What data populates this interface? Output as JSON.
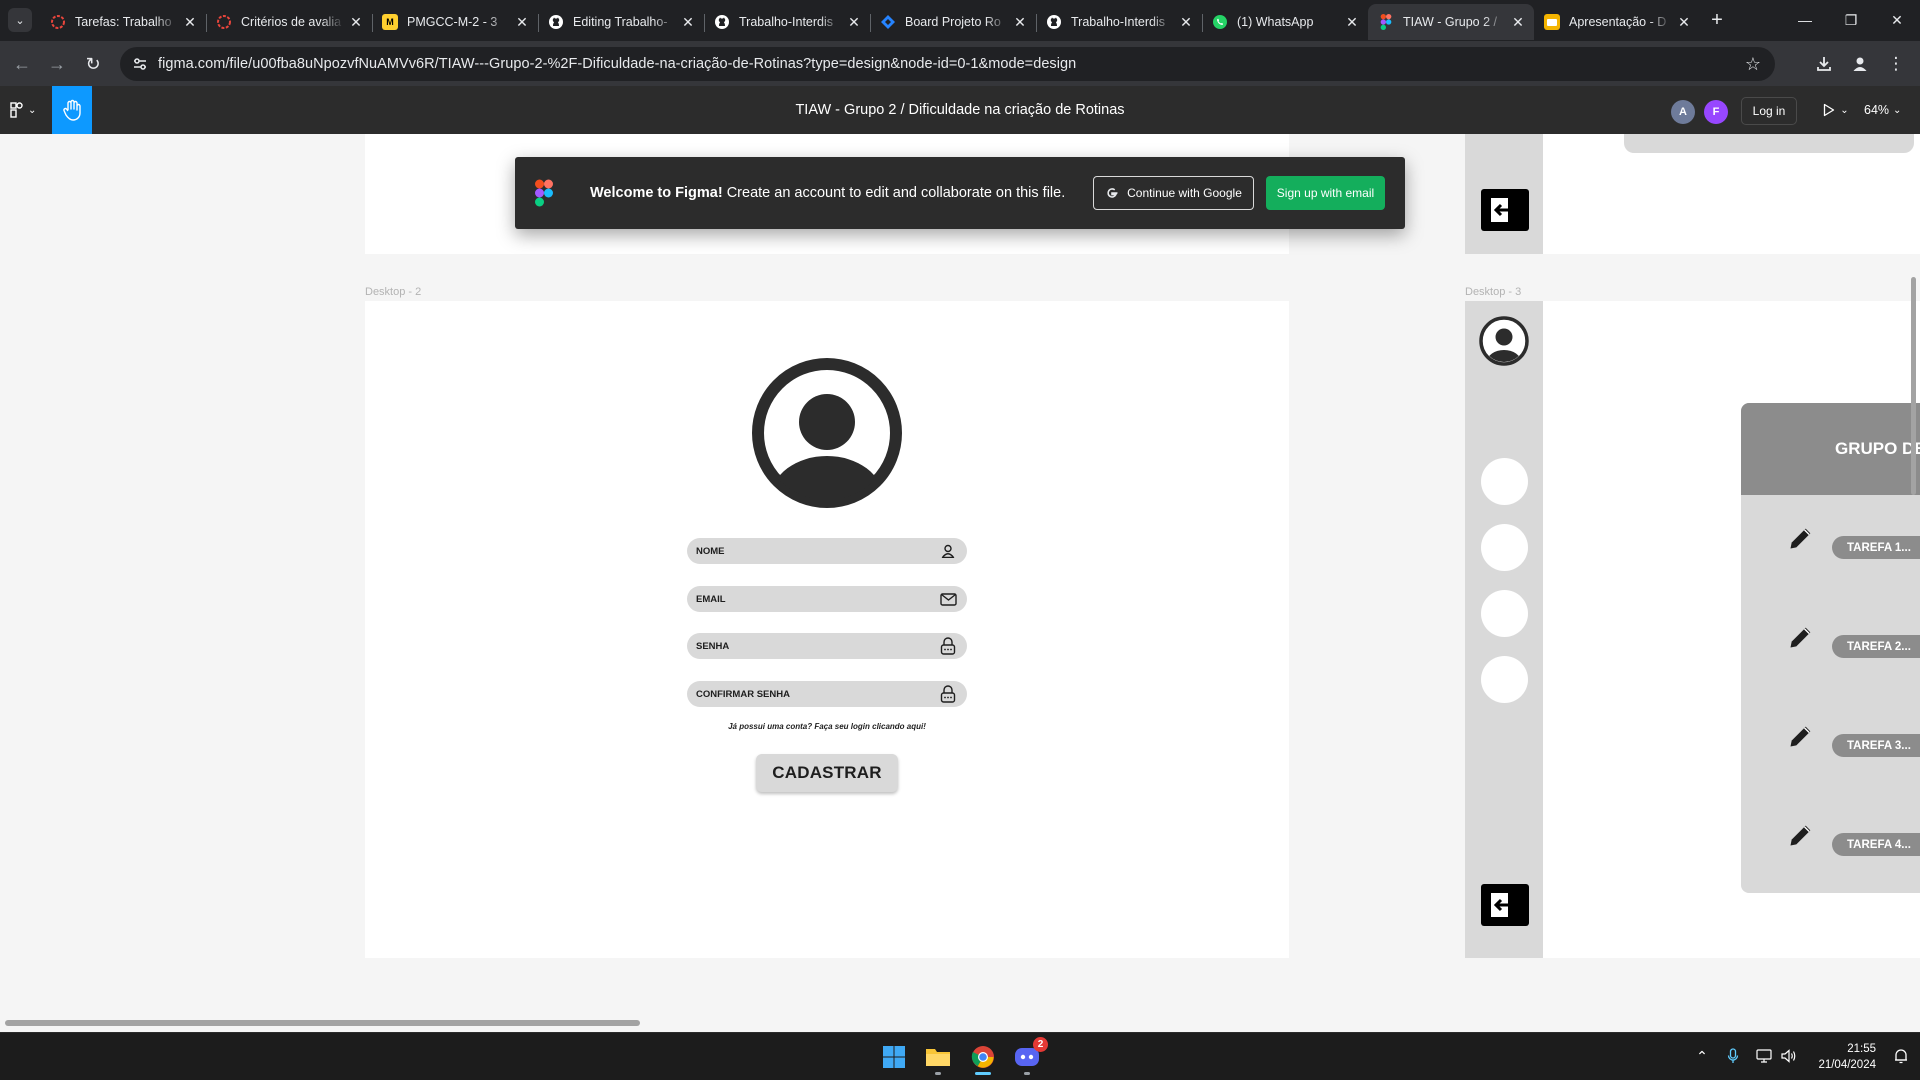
{
  "browser": {
    "tabs": [
      {
        "title": "Tarefas: Trabalho",
        "favicon": "moodle-ring-icon",
        "color": "#e8453c"
      },
      {
        "title": "Critérios de avalia",
        "favicon": "moodle-ring-icon",
        "color": "#e8453c"
      },
      {
        "title": "PMGCC-M-2 - 3",
        "favicon": "miro-icon",
        "color": "#ffd02f"
      },
      {
        "title": "Editing Trabalho-",
        "favicon": "github-icon",
        "color": "#ffffff"
      },
      {
        "title": "Trabalho-Interdis",
        "favicon": "github-icon",
        "color": "#ffffff"
      },
      {
        "title": "Board Projeto Ro",
        "favicon": "jira-icon",
        "color": "#2684ff"
      },
      {
        "title": "Trabalho-Interdis",
        "favicon": "github-icon",
        "color": "#ffffff"
      },
      {
        "title": "(1) WhatsApp",
        "favicon": "whatsapp-icon",
        "color": "#25d366"
      },
      {
        "title": "TIAW - Grupo 2 /",
        "favicon": "figma-icon",
        "color": "#a259ff",
        "active": true
      },
      {
        "title": "Apresentação - D",
        "favicon": "slides-icon",
        "color": "#f4b400"
      }
    ],
    "url": "figma.com/file/u00fba8uNpozvfNuAMVv6R/TIAW---Grupo-2-%2F-Dificuldade-na-criação-de-Rotinas?type=design&node-id=0-1&mode=design"
  },
  "figma": {
    "document_title": "TIAW - Grupo 2 / Dificuldade na criação de Rotinas",
    "avatars": [
      {
        "initial": "A",
        "color": "#6e7b9a"
      },
      {
        "initial": "F",
        "color": "#9747ff"
      }
    ],
    "login_label": "Log in",
    "zoom": "64%"
  },
  "banner": {
    "title": "Welcome to Figma!",
    "text": "Create an account to edit and collaborate on this file.",
    "google_label": "Continue with Google",
    "email_label": "Sign up with email"
  },
  "canvas": {
    "frame2_label": "Desktop - 2",
    "frame3_label": "Desktop - 3",
    "form": {
      "fields": [
        {
          "label": "NOME",
          "icon": "user-icon"
        },
        {
          "label": "EMAIL",
          "icon": "mail-icon"
        },
        {
          "label": "SENHA",
          "icon": "lock-icon"
        },
        {
          "label": "CONFIRMAR SENHA",
          "icon": "lock-icon"
        }
      ],
      "login_hint": "Já possui uma conta? Faça seu login clicando aqui!",
      "submit_label": "CADASTRAR"
    },
    "group_title": "GRUPO DE",
    "tasks": [
      "TAREFA 1...",
      "TAREFA 2...",
      "TAREFA 3...",
      "TAREFA 4..."
    ]
  },
  "taskbar": {
    "time": "21:55",
    "date": "21/04/2024",
    "discord_badge": "2"
  }
}
